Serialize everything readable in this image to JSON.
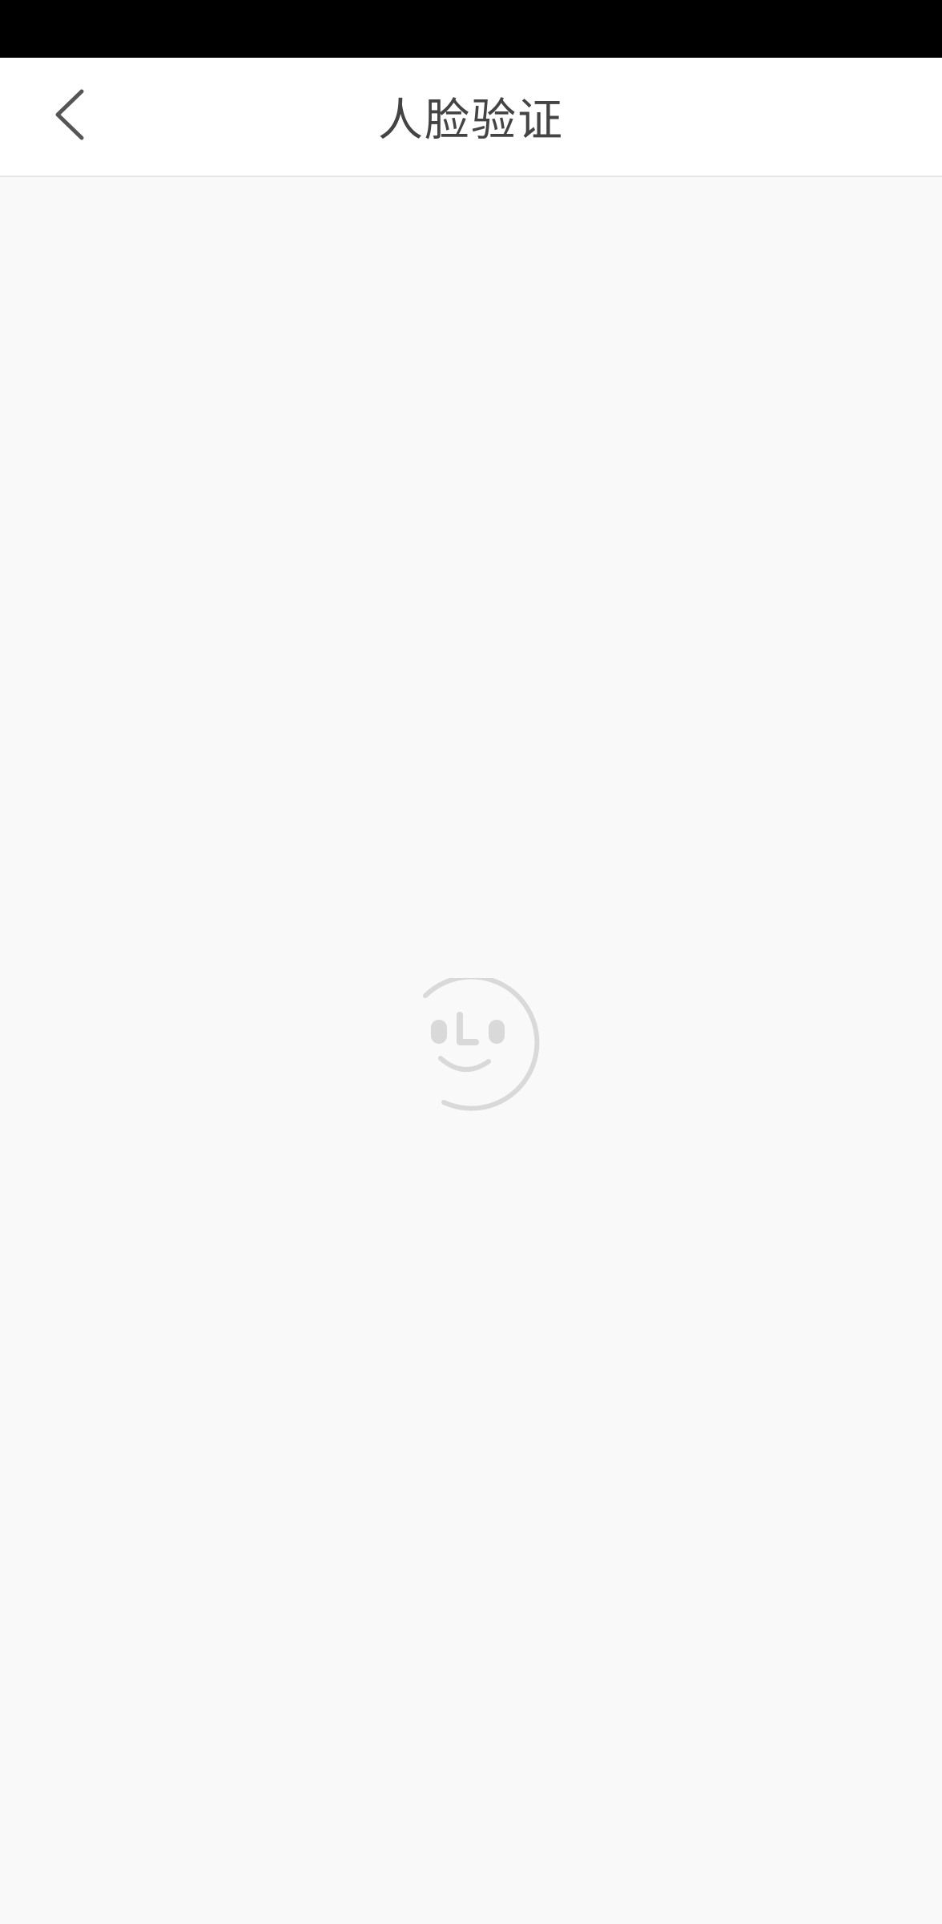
{
  "status_bar": {},
  "header": {
    "title": "人脸验证",
    "back_icon": "chevron-left-icon"
  },
  "main": {
    "loader_icon": "face-loading-icon"
  },
  "colors": {
    "status_bar": "#000000",
    "header_bg": "#ffffff",
    "page_bg": "#f9f9f9",
    "title_text": "#444444",
    "icon_gray": "#d9d9d9"
  }
}
